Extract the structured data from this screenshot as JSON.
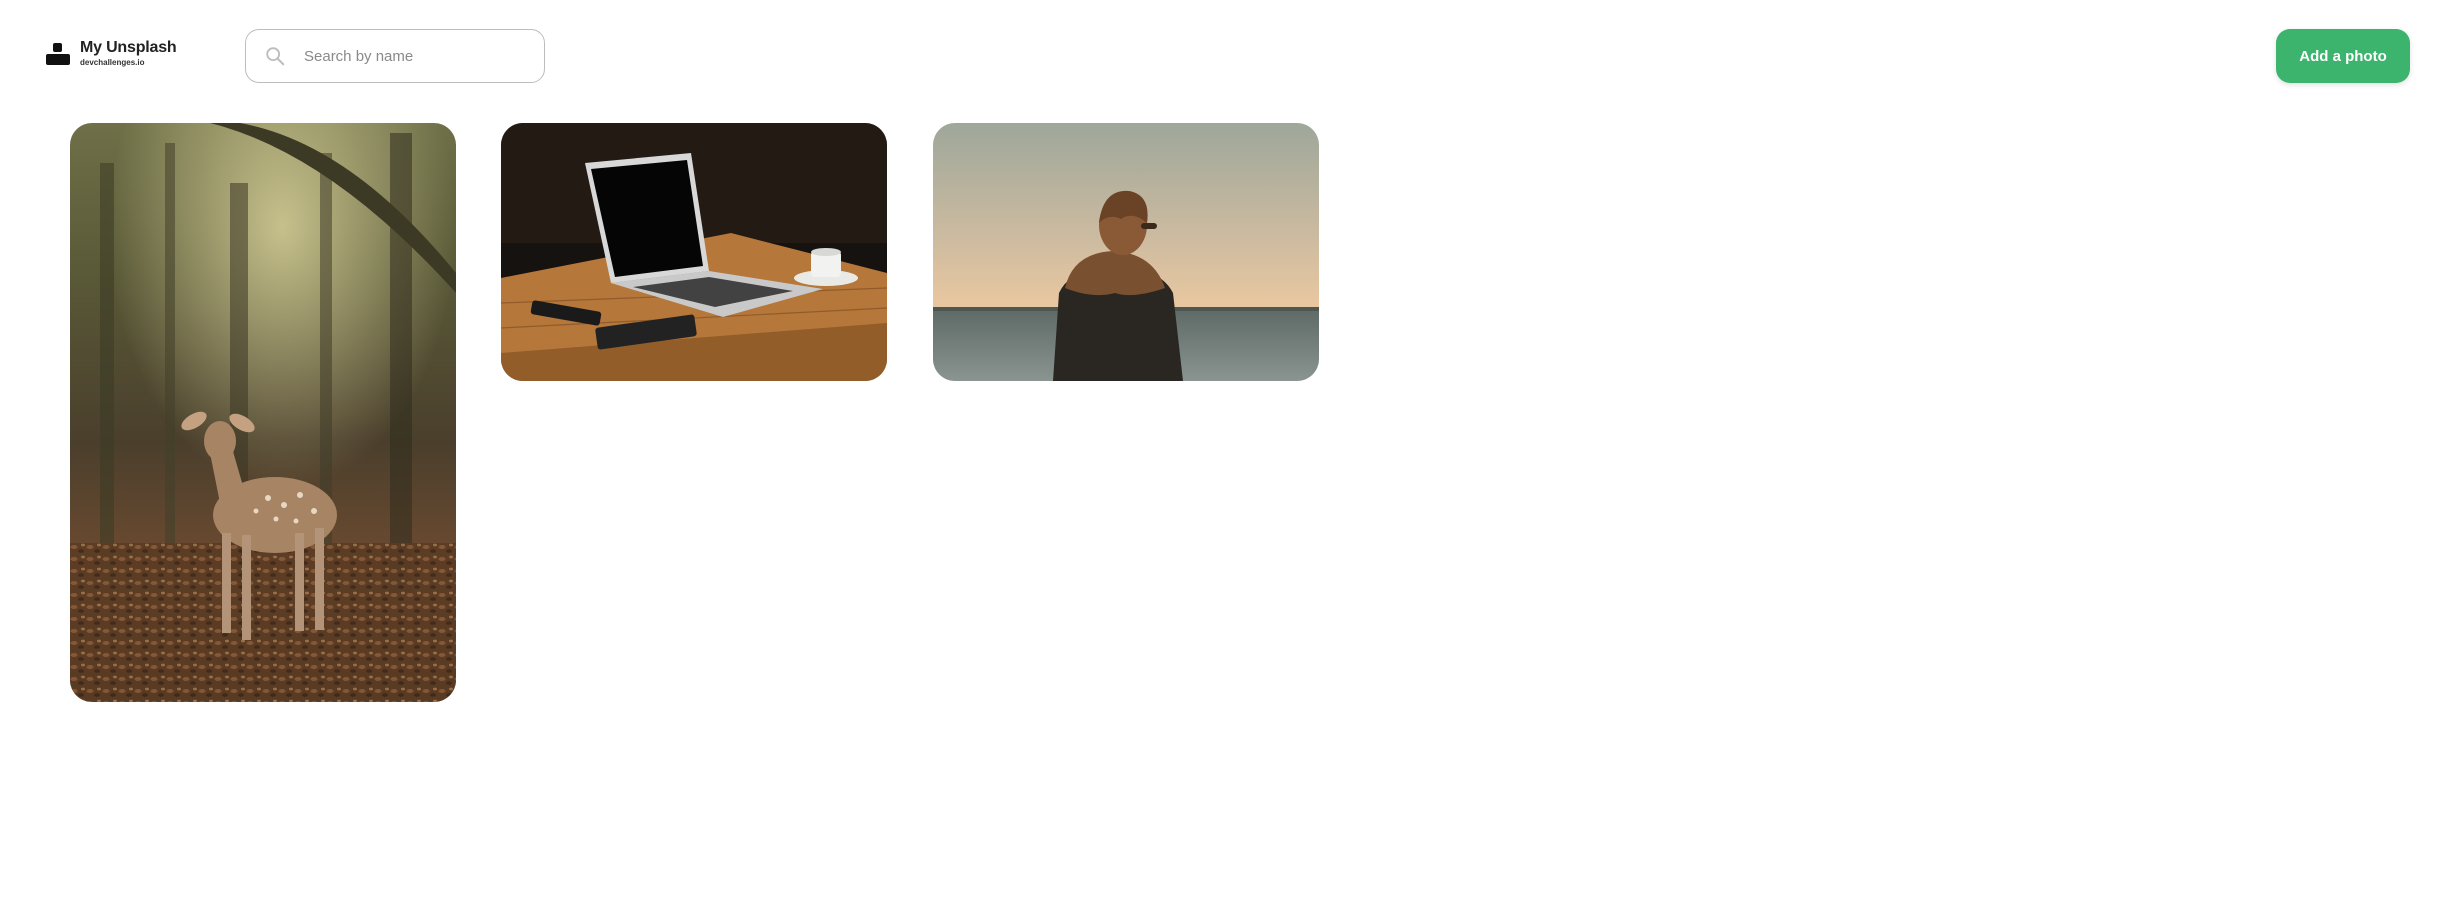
{
  "brand": {
    "title": "My Unsplash",
    "subtitle": "devchallenges.io",
    "logo_icon": "unsplash-user-mark-icon"
  },
  "search": {
    "placeholder": "Search by name",
    "value": "",
    "icon": "search-icon"
  },
  "actions": {
    "add_photo_label": "Add a photo",
    "add_photo_color": "#3db46d"
  },
  "gallery": {
    "photos": [
      {
        "subject": "deer"
      },
      {
        "subject": "laptop"
      },
      {
        "subject": "person"
      }
    ]
  }
}
